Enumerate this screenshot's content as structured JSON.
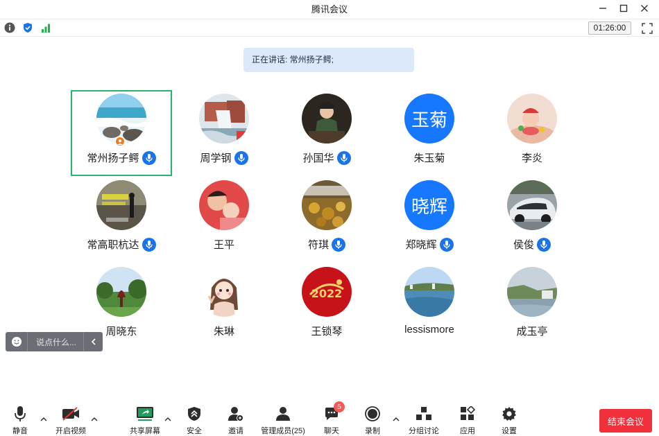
{
  "window": {
    "title": "腾讯会议"
  },
  "infobar": {
    "timer": "01:26:00"
  },
  "speaking": {
    "label": "正在讲话: 常州扬子鳄;"
  },
  "participants": [
    {
      "name": "常州扬子鳄",
      "mic": true,
      "host": true,
      "active": true,
      "avatar": "beach-photo"
    },
    {
      "name": "周学钢",
      "mic": true,
      "avatar": "waterfall-photo"
    },
    {
      "name": "孙国华",
      "mic": true,
      "avatar": "child-photo"
    },
    {
      "name": "朱玉菊",
      "mic": false,
      "avatar_text": "玉菊"
    },
    {
      "name": "李炎",
      "mic": false,
      "avatar": "baby-photo"
    },
    {
      "name": "常高职杭达",
      "mic": true,
      "avatar": "silhouette-photo"
    },
    {
      "name": "王平",
      "mic": false,
      "avatar": "family-photo"
    },
    {
      "name": "符琪",
      "mic": true,
      "avatar": "food-photo"
    },
    {
      "name": "郑晓辉",
      "mic": true,
      "avatar_text": "晓辉"
    },
    {
      "name": "侯俊",
      "mic": true,
      "avatar": "car-photo"
    },
    {
      "name": "周晓东",
      "mic": false,
      "avatar": "garden-photo"
    },
    {
      "name": "朱琳",
      "mic": false,
      "avatar": "cartoon-girl"
    },
    {
      "name": "王锁琴",
      "mic": false,
      "avatar": "red-2022-logo"
    },
    {
      "name": "lessismore",
      "mic": false,
      "avatar": "lake-photo"
    },
    {
      "name": "成玉亭",
      "mic": false,
      "avatar": "river-photo"
    }
  ],
  "chat": {
    "placeholder": "说点什么..."
  },
  "toolbar": {
    "mute": "静音",
    "video": "开启视频",
    "share": "共享屏幕",
    "security": "安全",
    "invite": "邀请",
    "members": "管理成员(25)",
    "chat": "聊天",
    "chat_badge": "5",
    "record": "录制",
    "breakout": "分组讨论",
    "apps": "应用",
    "settings": "设置",
    "end": "结束会议"
  },
  "colors": {
    "accent": "#1677ff",
    "active_border": "#29b36b",
    "end_button": "#f0303a",
    "share_green": "#1e9e5a"
  }
}
